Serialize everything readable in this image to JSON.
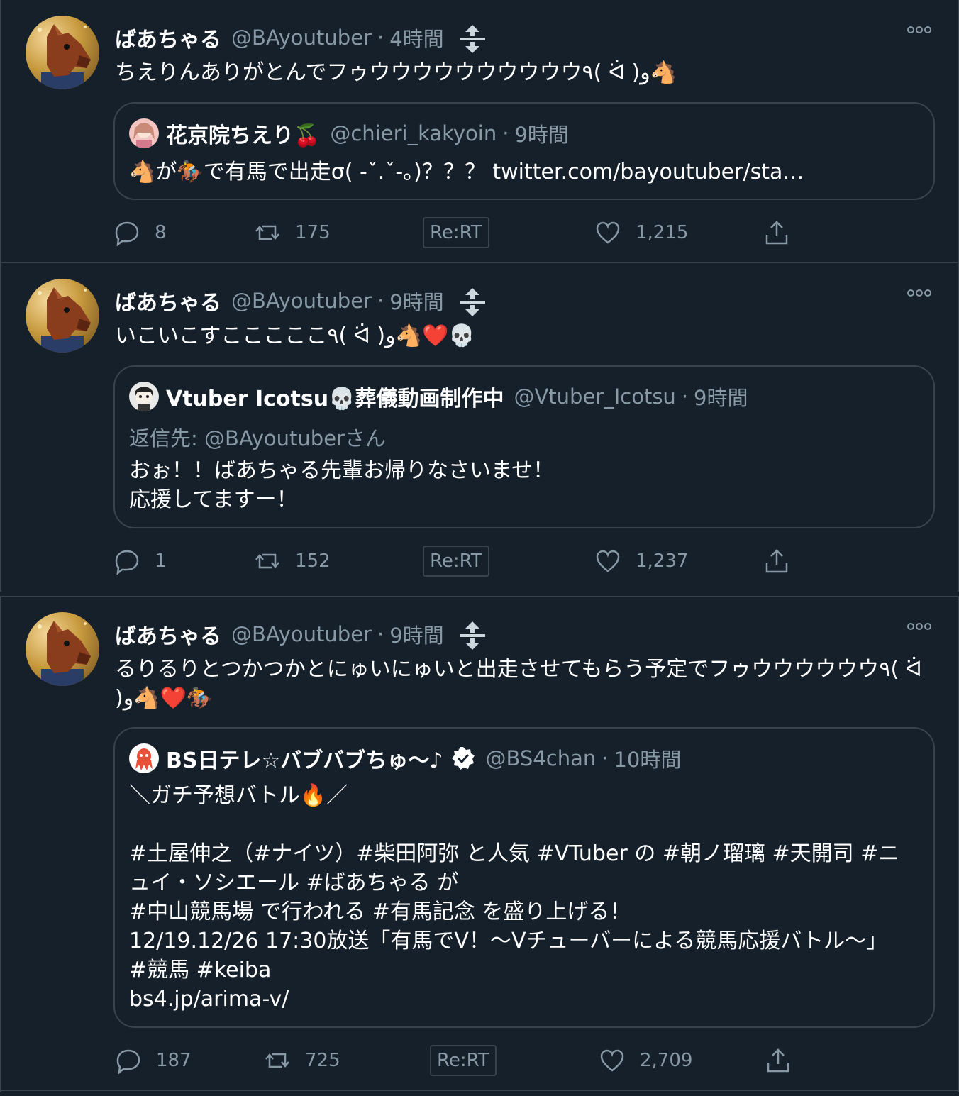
{
  "tweets": [
    {
      "name": "ばあちゃる",
      "handle": "@BAyoutuber",
      "time": "4時間",
      "text": "ちえりんありがとんでフゥウウウウウウウウウウ٩( ᐛ )و🐴",
      "quote": {
        "name": "花京院ちえり🍒",
        "handle": "@chieri_kakyoin",
        "time": "9時間",
        "reply_to": "",
        "text": "🐴が🏇で有馬で出走σ( -ˇ.ˇ-。)？？？ twitter.com/bayoutuber/sta…"
      },
      "replies": "8",
      "retweets": "175",
      "rert_label": "Re:RT",
      "likes": "1,215"
    },
    {
      "name": "ばあちゃる",
      "handle": "@BAyoutuber",
      "time": "9時間",
      "text": "いこいこすこここここ٩( ᐛ )و🐴❤️💀",
      "quote": {
        "name": "Vtuber Icotsu💀葬儀動画制作中",
        "handle": "@Vtuber_Icotsu",
        "time": "9時間",
        "reply_to": "返信先: @BAyoutuberさん",
        "text": "おぉ！！ばあちゃる先輩お帰りなさいませ！\n応援してますー！"
      },
      "replies": "1",
      "retweets": "152",
      "rert_label": "Re:RT",
      "likes": "1,237"
    },
    {
      "name": "ばあちゃる",
      "handle": "@BAyoutuber",
      "time": "9時間",
      "text": "るりるりとつかつかとにゅいにゅいと出走させてもらう予定でフゥウウウウウウ٩( ᐛ )و🐴❤️🏇",
      "quote": {
        "name": "BS日テレ☆バブバブちゅ～♪",
        "handle": "@BS4chan",
        "time": "10時間",
        "reply_to": "",
        "text": "＼ガチ予想バトル🔥／\n\n#土屋伸之（#ナイツ）#柴田阿弥 と人気 #VTuber の #朝ノ瑠璃 #天開司 #ニュイ・ソシエール #ばあちゃる が\n#中山競馬場 で行われる #有馬記念 を盛り上げる！\n12/19.12/26 17:30放送「有馬でV！～Vチューバーによる競馬応援バトル～」\n#競馬 #keiba\nbs4.jp/arima-v/"
      },
      "replies": "187",
      "retweets": "725",
      "rert_label": "Re:RT",
      "likes": "2,709"
    }
  ],
  "icons": {
    "reply": "reply-icon",
    "retweet": "retweet-icon",
    "like": "heart-icon",
    "share": "share-icon",
    "more": "more-icon",
    "swap": "swap-icon",
    "verified": "verified-icon"
  },
  "colors": {
    "background": "#15202b",
    "border": "#38444d",
    "secondary_text": "#8899a6",
    "primary_text": "#ffffff"
  }
}
